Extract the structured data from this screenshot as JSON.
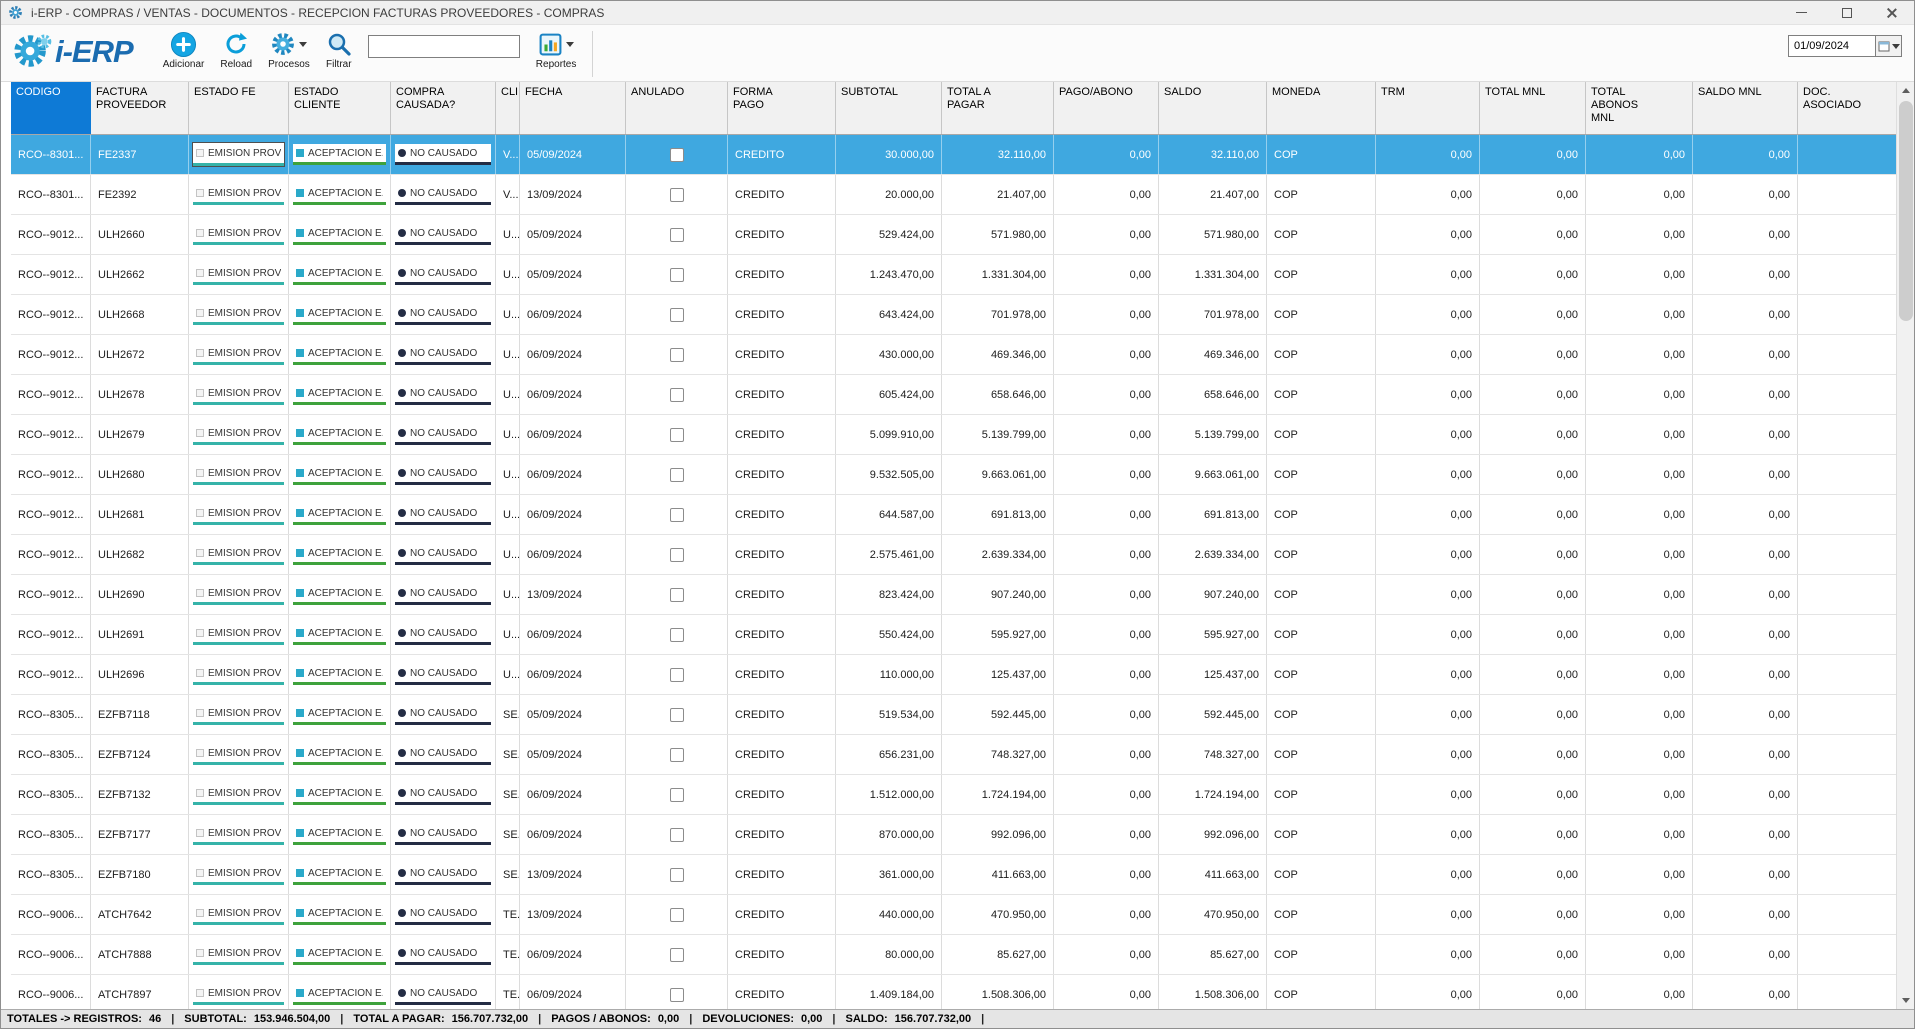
{
  "window": {
    "title": "i-ERP - COMPRAS / VENTAS - DOCUMENTOS - RECEPCION FACTURAS PROVEEDORES - COMPRAS"
  },
  "icons": {
    "app": "gear",
    "logo": "double-gear",
    "adicionar": "plus-circle",
    "reload": "circular-arrow",
    "procesos": "gear",
    "filtrar": "magnifier",
    "reportes": "report-chart",
    "date_dropdown": "calendar-caret",
    "minimize": "bar",
    "maximize": "square",
    "close": "x"
  },
  "colors": {
    "accent_blue": "#14a5e3",
    "header_selected": "#0e7ad6",
    "row_selected": "#3fa8e0",
    "status_fe_underline": "#35b3a9",
    "status_cliente_underline": "#3ea23c",
    "status_causada_underline": "#232c44"
  },
  "toolbar": {
    "logo_text": "i-ERP",
    "adicionar_label": "Adicionar",
    "reload_label": "Reload",
    "procesos_label": "Procesos",
    "filtrar_label": "Filtrar",
    "reportes_label": "Reportes",
    "search_value": "",
    "date_value": "01/09/2024"
  },
  "table": {
    "columns": [
      "CODIGO",
      "FACTURA PROVEEDOR",
      "ESTADO FE",
      "ESTADO CLIENTE",
      "COMPRA CAUSADA?",
      "CLI...",
      "FECHA",
      "ANULADO",
      "FORMA PAGO",
      "SUBTOTAL",
      "TOTAL A PAGAR",
      "PAGO/ABONO",
      "SALDO",
      "MONEDA",
      "TRM",
      "TOTAL MNL",
      "TOTAL ABONOS MNL",
      "SALDO MNL",
      "DOC. ASOCIADO"
    ],
    "selected_column": "CODIGO",
    "rows": [
      {
        "codigo": "RCO--8301...",
        "factura_proveedor": "FE2337",
        "estado_fe": "EMISION PROV",
        "estado_cliente": "ACEPTACION E...",
        "compra_causada": "NO CAUSADO",
        "cli": "V...",
        "fecha": "05/09/2024",
        "anulado": false,
        "forma_pago": "CREDITO",
        "subtotal": "30.000,00",
        "total_a_pagar": "32.110,00",
        "pago_abono": "0,00",
        "saldo": "32.110,00",
        "moneda": "COP",
        "trm": "0,00",
        "total_mnl": "0,00",
        "total_abonos_mnl": "0,00",
        "saldo_mnl": "0,00",
        "doc_asociado": "",
        "selected": true
      },
      {
        "codigo": "RCO--8301...",
        "factura_proveedor": "FE2392",
        "estado_fe": "EMISION PROV",
        "estado_cliente": "ACEPTACION E...",
        "compra_causada": "NO CAUSADO",
        "cli": "V...",
        "fecha": "13/09/2024",
        "anulado": false,
        "forma_pago": "CREDITO",
        "subtotal": "20.000,00",
        "total_a_pagar": "21.407,00",
        "pago_abono": "0,00",
        "saldo": "21.407,00",
        "moneda": "COP",
        "trm": "0,00",
        "total_mnl": "0,00",
        "total_abonos_mnl": "0,00",
        "saldo_mnl": "0,00",
        "doc_asociado": "",
        "selected": false
      },
      {
        "codigo": "RCO--9012...",
        "factura_proveedor": "ULH2660",
        "estado_fe": "EMISION PROV",
        "estado_cliente": "ACEPTACION E...",
        "compra_causada": "NO CAUSADO",
        "cli": "U...",
        "fecha": "05/09/2024",
        "anulado": false,
        "forma_pago": "CREDITO",
        "subtotal": "529.424,00",
        "total_a_pagar": "571.980,00",
        "pago_abono": "0,00",
        "saldo": "571.980,00",
        "moneda": "COP",
        "trm": "0,00",
        "total_mnl": "0,00",
        "total_abonos_mnl": "0,00",
        "saldo_mnl": "0,00",
        "doc_asociado": "",
        "selected": false
      },
      {
        "codigo": "RCO--9012...",
        "factura_proveedor": "ULH2662",
        "estado_fe": "EMISION PROV",
        "estado_cliente": "ACEPTACION E...",
        "compra_causada": "NO CAUSADO",
        "cli": "U...",
        "fecha": "05/09/2024",
        "anulado": false,
        "forma_pago": "CREDITO",
        "subtotal": "1.243.470,00",
        "total_a_pagar": "1.331.304,00",
        "pago_abono": "0,00",
        "saldo": "1.331.304,00",
        "moneda": "COP",
        "trm": "0,00",
        "total_mnl": "0,00",
        "total_abonos_mnl": "0,00",
        "saldo_mnl": "0,00",
        "doc_asociado": "",
        "selected": false
      },
      {
        "codigo": "RCO--9012...",
        "factura_proveedor": "ULH2668",
        "estado_fe": "EMISION PROV",
        "estado_cliente": "ACEPTACION E...",
        "compra_causada": "NO CAUSADO",
        "cli": "U...",
        "fecha": "06/09/2024",
        "anulado": false,
        "forma_pago": "CREDITO",
        "subtotal": "643.424,00",
        "total_a_pagar": "701.978,00",
        "pago_abono": "0,00",
        "saldo": "701.978,00",
        "moneda": "COP",
        "trm": "0,00",
        "total_mnl": "0,00",
        "total_abonos_mnl": "0,00",
        "saldo_mnl": "0,00",
        "doc_asociado": "",
        "selected": false
      },
      {
        "codigo": "RCO--9012...",
        "factura_proveedor": "ULH2672",
        "estado_fe": "EMISION PROV",
        "estado_cliente": "ACEPTACION E...",
        "compra_causada": "NO CAUSADO",
        "cli": "U...",
        "fecha": "06/09/2024",
        "anulado": false,
        "forma_pago": "CREDITO",
        "subtotal": "430.000,00",
        "total_a_pagar": "469.346,00",
        "pago_abono": "0,00",
        "saldo": "469.346,00",
        "moneda": "COP",
        "trm": "0,00",
        "total_mnl": "0,00",
        "total_abonos_mnl": "0,00",
        "saldo_mnl": "0,00",
        "doc_asociado": "",
        "selected": false
      },
      {
        "codigo": "RCO--9012...",
        "factura_proveedor": "ULH2678",
        "estado_fe": "EMISION PROV",
        "estado_cliente": "ACEPTACION E...",
        "compra_causada": "NO CAUSADO",
        "cli": "U...",
        "fecha": "06/09/2024",
        "anulado": false,
        "forma_pago": "CREDITO",
        "subtotal": "605.424,00",
        "total_a_pagar": "658.646,00",
        "pago_abono": "0,00",
        "saldo": "658.646,00",
        "moneda": "COP",
        "trm": "0,00",
        "total_mnl": "0,00",
        "total_abonos_mnl": "0,00",
        "saldo_mnl": "0,00",
        "doc_asociado": "",
        "selected": false
      },
      {
        "codigo": "RCO--9012...",
        "factura_proveedor": "ULH2679",
        "estado_fe": "EMISION PROV",
        "estado_cliente": "ACEPTACION E...",
        "compra_causada": "NO CAUSADO",
        "cli": "U...",
        "fecha": "06/09/2024",
        "anulado": false,
        "forma_pago": "CREDITO",
        "subtotal": "5.099.910,00",
        "total_a_pagar": "5.139.799,00",
        "pago_abono": "0,00",
        "saldo": "5.139.799,00",
        "moneda": "COP",
        "trm": "0,00",
        "total_mnl": "0,00",
        "total_abonos_mnl": "0,00",
        "saldo_mnl": "0,00",
        "doc_asociado": "",
        "selected": false
      },
      {
        "codigo": "RCO--9012...",
        "factura_proveedor": "ULH2680",
        "estado_fe": "EMISION PROV",
        "estado_cliente": "ACEPTACION E...",
        "compra_causada": "NO CAUSADO",
        "cli": "U...",
        "fecha": "06/09/2024",
        "anulado": false,
        "forma_pago": "CREDITO",
        "subtotal": "9.532.505,00",
        "total_a_pagar": "9.663.061,00",
        "pago_abono": "0,00",
        "saldo": "9.663.061,00",
        "moneda": "COP",
        "trm": "0,00",
        "total_mnl": "0,00",
        "total_abonos_mnl": "0,00",
        "saldo_mnl": "0,00",
        "doc_asociado": "",
        "selected": false
      },
      {
        "codigo": "RCO--9012...",
        "factura_proveedor": "ULH2681",
        "estado_fe": "EMISION PROV",
        "estado_cliente": "ACEPTACION E...",
        "compra_causada": "NO CAUSADO",
        "cli": "U...",
        "fecha": "06/09/2024",
        "anulado": false,
        "forma_pago": "CREDITO",
        "subtotal": "644.587,00",
        "total_a_pagar": "691.813,00",
        "pago_abono": "0,00",
        "saldo": "691.813,00",
        "moneda": "COP",
        "trm": "0,00",
        "total_mnl": "0,00",
        "total_abonos_mnl": "0,00",
        "saldo_mnl": "0,00",
        "doc_asociado": "",
        "selected": false
      },
      {
        "codigo": "RCO--9012...",
        "factura_proveedor": "ULH2682",
        "estado_fe": "EMISION PROV",
        "estado_cliente": "ACEPTACION E...",
        "compra_causada": "NO CAUSADO",
        "cli": "U...",
        "fecha": "06/09/2024",
        "anulado": false,
        "forma_pago": "CREDITO",
        "subtotal": "2.575.461,00",
        "total_a_pagar": "2.639.334,00",
        "pago_abono": "0,00",
        "saldo": "2.639.334,00",
        "moneda": "COP",
        "trm": "0,00",
        "total_mnl": "0,00",
        "total_abonos_mnl": "0,00",
        "saldo_mnl": "0,00",
        "doc_asociado": "",
        "selected": false
      },
      {
        "codigo": "RCO--9012...",
        "factura_proveedor": "ULH2690",
        "estado_fe": "EMISION PROV",
        "estado_cliente": "ACEPTACION E...",
        "compra_causada": "NO CAUSADO",
        "cli": "U...",
        "fecha": "13/09/2024",
        "anulado": false,
        "forma_pago": "CREDITO",
        "subtotal": "823.424,00",
        "total_a_pagar": "907.240,00",
        "pago_abono": "0,00",
        "saldo": "907.240,00",
        "moneda": "COP",
        "trm": "0,00",
        "total_mnl": "0,00",
        "total_abonos_mnl": "0,00",
        "saldo_mnl": "0,00",
        "doc_asociado": "",
        "selected": false
      },
      {
        "codigo": "RCO--9012...",
        "factura_proveedor": "ULH2691",
        "estado_fe": "EMISION PROV",
        "estado_cliente": "ACEPTACION E...",
        "compra_causada": "NO CAUSADO",
        "cli": "U...",
        "fecha": "06/09/2024",
        "anulado": false,
        "forma_pago": "CREDITO",
        "subtotal": "550.424,00",
        "total_a_pagar": "595.927,00",
        "pago_abono": "0,00",
        "saldo": "595.927,00",
        "moneda": "COP",
        "trm": "0,00",
        "total_mnl": "0,00",
        "total_abonos_mnl": "0,00",
        "saldo_mnl": "0,00",
        "doc_asociado": "",
        "selected": false
      },
      {
        "codigo": "RCO--9012...",
        "factura_proveedor": "ULH2696",
        "estado_fe": "EMISION PROV",
        "estado_cliente": "ACEPTACION E...",
        "compra_causada": "NO CAUSADO",
        "cli": "U...",
        "fecha": "06/09/2024",
        "anulado": false,
        "forma_pago": "CREDITO",
        "subtotal": "110.000,00",
        "total_a_pagar": "125.437,00",
        "pago_abono": "0,00",
        "saldo": "125.437,00",
        "moneda": "COP",
        "trm": "0,00",
        "total_mnl": "0,00",
        "total_abonos_mnl": "0,00",
        "saldo_mnl": "0,00",
        "doc_asociado": "",
        "selected": false
      },
      {
        "codigo": "RCO--8305...",
        "factura_proveedor": "EZFB7118",
        "estado_fe": "EMISION PROV",
        "estado_cliente": "ACEPTACION E...",
        "compra_causada": "NO CAUSADO",
        "cli": "SE...",
        "fecha": "05/09/2024",
        "anulado": false,
        "forma_pago": "CREDITO",
        "subtotal": "519.534,00",
        "total_a_pagar": "592.445,00",
        "pago_abono": "0,00",
        "saldo": "592.445,00",
        "moneda": "COP",
        "trm": "0,00",
        "total_mnl": "0,00",
        "total_abonos_mnl": "0,00",
        "saldo_mnl": "0,00",
        "doc_asociado": "",
        "selected": false
      },
      {
        "codigo": "RCO--8305...",
        "factura_proveedor": "EZFB7124",
        "estado_fe": "EMISION PROV",
        "estado_cliente": "ACEPTACION E...",
        "compra_causada": "NO CAUSADO",
        "cli": "SE...",
        "fecha": "05/09/2024",
        "anulado": false,
        "forma_pago": "CREDITO",
        "subtotal": "656.231,00",
        "total_a_pagar": "748.327,00",
        "pago_abono": "0,00",
        "saldo": "748.327,00",
        "moneda": "COP",
        "trm": "0,00",
        "total_mnl": "0,00",
        "total_abonos_mnl": "0,00",
        "saldo_mnl": "0,00",
        "doc_asociado": "",
        "selected": false
      },
      {
        "codigo": "RCO--8305...",
        "factura_proveedor": "EZFB7132",
        "estado_fe": "EMISION PROV",
        "estado_cliente": "ACEPTACION E...",
        "compra_causada": "NO CAUSADO",
        "cli": "SE...",
        "fecha": "06/09/2024",
        "anulado": false,
        "forma_pago": "CREDITO",
        "subtotal": "1.512.000,00",
        "total_a_pagar": "1.724.194,00",
        "pago_abono": "0,00",
        "saldo": "1.724.194,00",
        "moneda": "COP",
        "trm": "0,00",
        "total_mnl": "0,00",
        "total_abonos_mnl": "0,00",
        "saldo_mnl": "0,00",
        "doc_asociado": "",
        "selected": false
      },
      {
        "codigo": "RCO--8305...",
        "factura_proveedor": "EZFB7177",
        "estado_fe": "EMISION PROV",
        "estado_cliente": "ACEPTACION E...",
        "compra_causada": "NO CAUSADO",
        "cli": "SE...",
        "fecha": "06/09/2024",
        "anulado": false,
        "forma_pago": "CREDITO",
        "subtotal": "870.000,00",
        "total_a_pagar": "992.096,00",
        "pago_abono": "0,00",
        "saldo": "992.096,00",
        "moneda": "COP",
        "trm": "0,00",
        "total_mnl": "0,00",
        "total_abonos_mnl": "0,00",
        "saldo_mnl": "0,00",
        "doc_asociado": "",
        "selected": false
      },
      {
        "codigo": "RCO--8305...",
        "factura_proveedor": "EZFB7180",
        "estado_fe": "EMISION PROV",
        "estado_cliente": "ACEPTACION E...",
        "compra_causada": "NO CAUSADO",
        "cli": "SE...",
        "fecha": "13/09/2024",
        "anulado": false,
        "forma_pago": "CREDITO",
        "subtotal": "361.000,00",
        "total_a_pagar": "411.663,00",
        "pago_abono": "0,00",
        "saldo": "411.663,00",
        "moneda": "COP",
        "trm": "0,00",
        "total_mnl": "0,00",
        "total_abonos_mnl": "0,00",
        "saldo_mnl": "0,00",
        "doc_asociado": "",
        "selected": false
      },
      {
        "codigo": "RCO--9006...",
        "factura_proveedor": "ATCH7642",
        "estado_fe": "EMISION PROV",
        "estado_cliente": "ACEPTACION E...",
        "compra_causada": "NO CAUSADO",
        "cli": "TE...",
        "fecha": "13/09/2024",
        "anulado": false,
        "forma_pago": "CREDITO",
        "subtotal": "440.000,00",
        "total_a_pagar": "470.950,00",
        "pago_abono": "0,00",
        "saldo": "470.950,00",
        "moneda": "COP",
        "trm": "0,00",
        "total_mnl": "0,00",
        "total_abonos_mnl": "0,00",
        "saldo_mnl": "0,00",
        "doc_asociado": "",
        "selected": false
      },
      {
        "codigo": "RCO--9006...",
        "factura_proveedor": "ATCH7888",
        "estado_fe": "EMISION PROV",
        "estado_cliente": "ACEPTACION E...",
        "compra_causada": "NO CAUSADO",
        "cli": "TE...",
        "fecha": "06/09/2024",
        "anulado": false,
        "forma_pago": "CREDITO",
        "subtotal": "80.000,00",
        "total_a_pagar": "85.627,00",
        "pago_abono": "0,00",
        "saldo": "85.627,00",
        "moneda": "COP",
        "trm": "0,00",
        "total_mnl": "0,00",
        "total_abonos_mnl": "0,00",
        "saldo_mnl": "0,00",
        "doc_asociado": "",
        "selected": false
      },
      {
        "codigo": "RCO--9006...",
        "factura_proveedor": "ATCH7897",
        "estado_fe": "EMISION PROV",
        "estado_cliente": "ACEPTACION E...",
        "compra_causada": "NO CAUSADO",
        "cli": "TE...",
        "fecha": "06/09/2024",
        "anulado": false,
        "forma_pago": "CREDITO",
        "subtotal": "1.409.184,00",
        "total_a_pagar": "1.508.306,00",
        "pago_abono": "0,00",
        "saldo": "1.508.306,00",
        "moneda": "COP",
        "trm": "0,00",
        "total_mnl": "0,00",
        "total_abonos_mnl": "0,00",
        "saldo_mnl": "0,00",
        "doc_asociado": "",
        "selected": false
      }
    ]
  },
  "statusbar": {
    "separator": "|",
    "segments": [
      {
        "label": "TOTALES -> REGISTROS:",
        "value": "46"
      },
      {
        "label": "SUBTOTAL:",
        "value": "153.946.504,00"
      },
      {
        "label": "TOTAL A PAGAR:",
        "value": "156.707.732,00"
      },
      {
        "label": "PAGOS / ABONOS:",
        "value": "0,00"
      },
      {
        "label": "DEVOLUCIONES:",
        "value": "0,00"
      },
      {
        "label": "SALDO:",
        "value": "156.707.732,00"
      }
    ]
  }
}
